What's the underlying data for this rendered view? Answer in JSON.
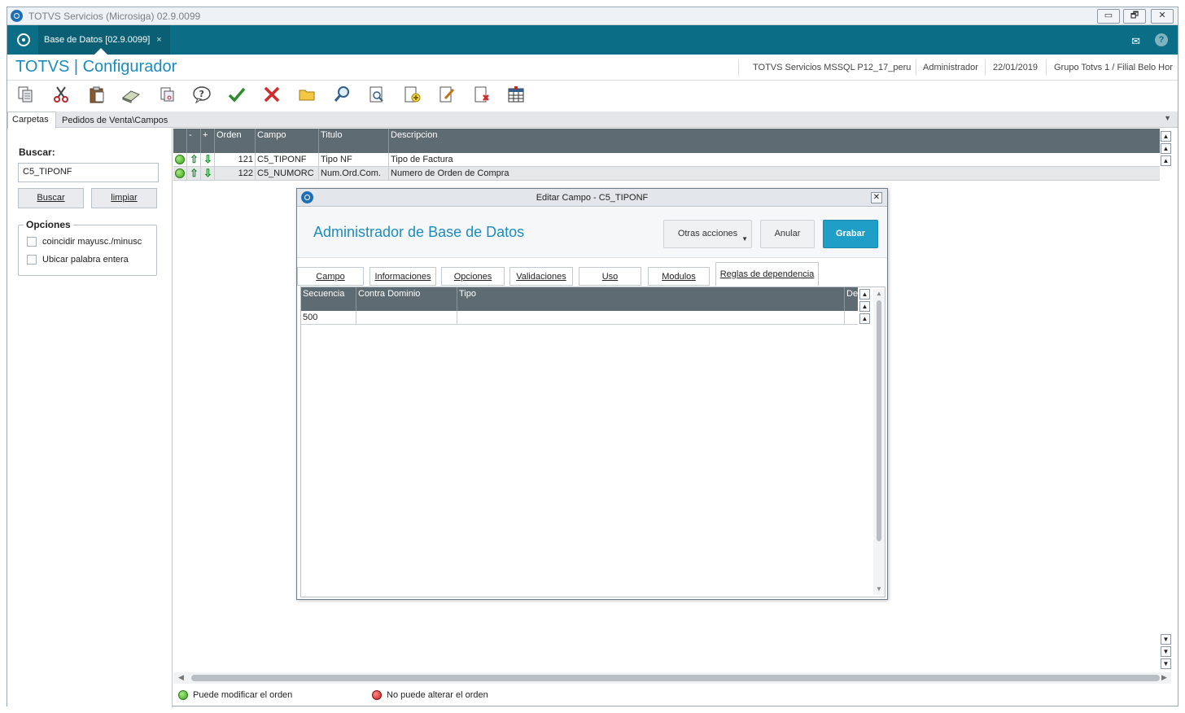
{
  "os_window": {
    "title": "TOTVS Servicios (Microsiga) 02.9.0099",
    "controls": [
      "▭",
      "🗗",
      "✕"
    ]
  },
  "tabbar": {
    "active_tab": "Base de Datos [02.9.0099]",
    "close_glyph": "×",
    "mail_glyph": "✉",
    "help_glyph": "?"
  },
  "header": {
    "brand": "TOTVS | Configurador",
    "environment": "TOTVS Servicios MSSQL P12_17_peru",
    "user": "Administrador",
    "date": "22/01/2019",
    "branch": "Grupo Totvs 1 / Filial Belo Hor"
  },
  "toolbar": {
    "icons": [
      "copy-icon",
      "cut-icon",
      "paste-icon",
      "eraser-icon",
      "scissors-copy-icon",
      "help-bubble-icon",
      "confirm-check-icon",
      "cancel-x-icon",
      "folder-icon",
      "search-icon",
      "preview-icon",
      "add-document-icon",
      "edit-document-icon",
      "delete-document-icon",
      "table-icon"
    ]
  },
  "tabs": {
    "left": "Carpetas",
    "right": "Pedidos de Venta\\Campos"
  },
  "left_panel": {
    "search_label": "Buscar:",
    "search_value": "C5_TIPONF",
    "search_button": "Buscar",
    "clear_button": "limpiar",
    "options_title": "Opciones",
    "options": [
      {
        "label": "coincidir mayusc./minusc",
        "checked": false
      },
      {
        "label": "Ubicar palabra entera",
        "checked": false
      }
    ]
  },
  "grid": {
    "headers": [
      "-",
      "+",
      "Orden",
      "Campo",
      "Titulo",
      "Descripcion"
    ],
    "rows": [
      {
        "status": "green",
        "orden": "121",
        "campo": "C5_TIPONF",
        "titulo": "Tipo NF",
        "descripcion": "Tipo de Factura"
      },
      {
        "status": "green",
        "orden": "122",
        "campo": "C5_NUMORC",
        "titulo": "Num.Ord.Com.",
        "descripcion": "Numero de Orden de Compra"
      }
    ]
  },
  "legend": {
    "ok": "Puede modificar el orden",
    "no": "No puede alterar el orden"
  },
  "modal": {
    "title": "Editar Campo - C5_TIPONF",
    "heading": "Administrador de Base de Datos",
    "buttons": {
      "more": "Otras acciones",
      "cancel": "Anular",
      "save": "Grabar"
    },
    "tabs": [
      "Campo",
      "Informaciones",
      "Opciones",
      "Validaciones",
      "Uso",
      "Modulos",
      "Reglas de dependencia"
    ],
    "active_tab": "Reglas de dependencia",
    "inner_grid": {
      "headers": [
        "Secuencia",
        "Contra Dominio",
        "Tipo",
        "De"
      ],
      "rows": [
        {
          "secuencia": "500",
          "contra_dominio": "",
          "tipo": ""
        }
      ]
    }
  }
}
